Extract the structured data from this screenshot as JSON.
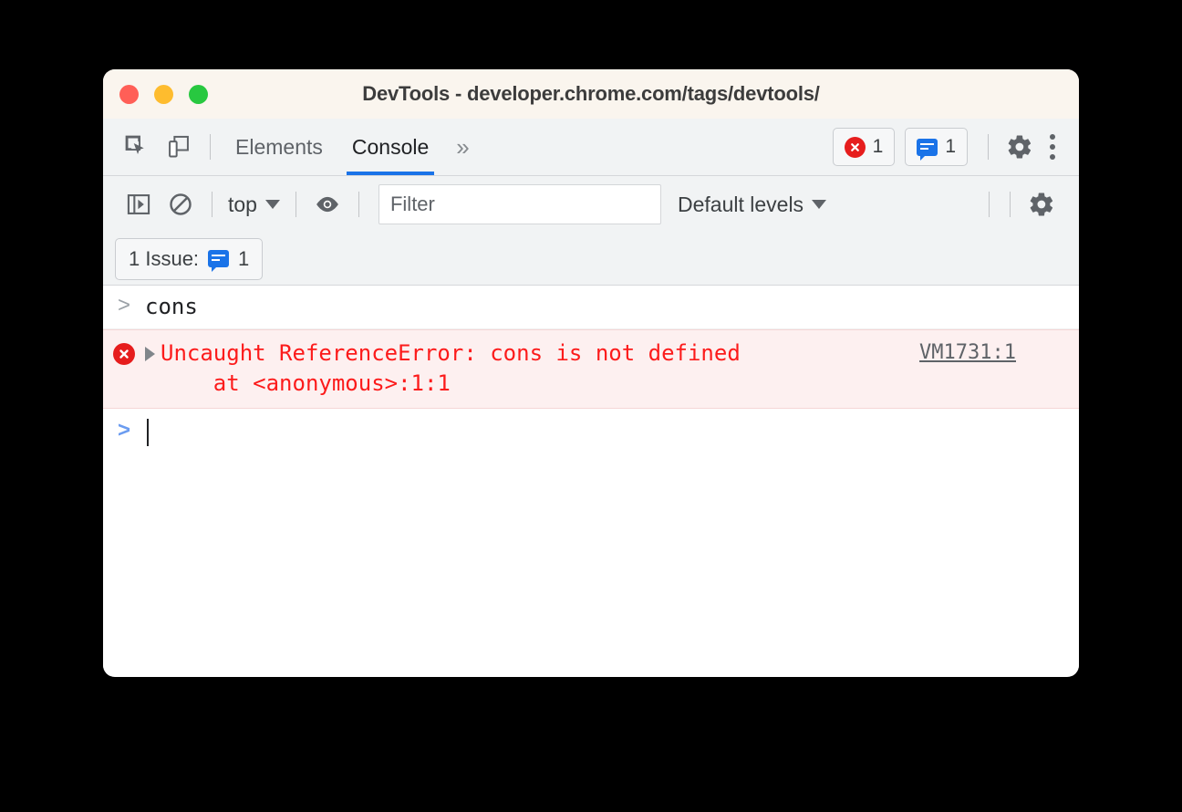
{
  "window": {
    "title": "DevTools - developer.chrome.com/tags/devtools/",
    "controls": {
      "close": "close",
      "minimize": "minimize",
      "maximize": "maximize"
    }
  },
  "tabbar": {
    "icons": [
      {
        "name": "inspect-element-icon",
        "label": "Inspect element"
      },
      {
        "name": "device-toolbar-icon",
        "label": "Toggle device toolbar"
      }
    ],
    "tabs": [
      {
        "label": "Elements",
        "active": false
      },
      {
        "label": "Console",
        "active": true
      }
    ],
    "more_tabs": "»",
    "error_count": "1",
    "issue_count": "1",
    "settings_label": "Settings",
    "menu_label": "Customize and control DevTools"
  },
  "console_toolbar": {
    "sidebar_toggle_label": "Show console sidebar",
    "clear_label": "Clear console",
    "context": "top",
    "eye_label": "Create live expression",
    "filter_placeholder": "Filter",
    "filter_value": "",
    "levels": "Default levels",
    "settings_label": "Console settings"
  },
  "issues_bar": {
    "text": "1 Issue:",
    "count": "1"
  },
  "console": {
    "entries": [
      {
        "type": "input",
        "prompt": ">",
        "text": "cons"
      },
      {
        "type": "error",
        "expand": "▶",
        "message_line1": "Uncaught ReferenceError: cons is not defined",
        "message_line2": "    at <anonymous>:1:1",
        "source": "VM1731:1"
      },
      {
        "type": "prompt",
        "prompt": ">",
        "text": ""
      }
    ]
  },
  "colors": {
    "accent_blue": "#1a73e8",
    "error_red": "#e61d1d",
    "error_text": "#fc1b1b",
    "error_bg": "#fdf0f0",
    "toolbar_bg": "#f1f3f4",
    "titlebar_bg": "#faf5ee",
    "traffic_red": "#ff5f57",
    "traffic_yellow": "#febc2e",
    "traffic_green": "#28c840"
  }
}
